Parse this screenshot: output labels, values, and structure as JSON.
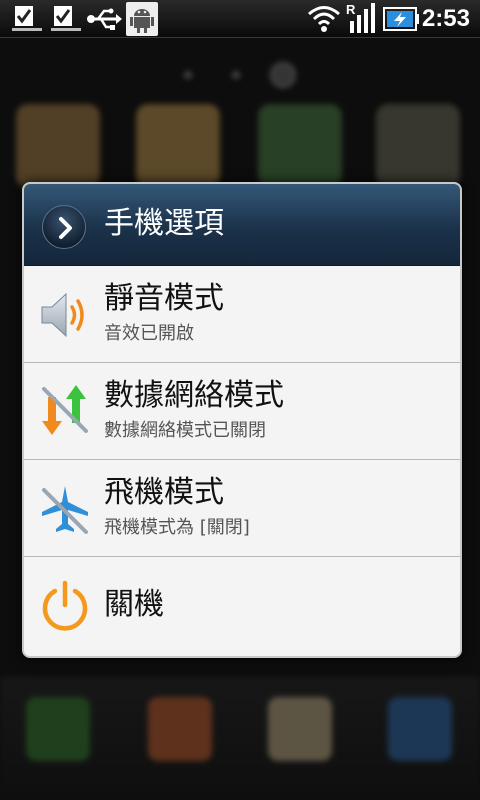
{
  "status_bar": {
    "time": "2:53",
    "roaming_indicator": "R",
    "icons": [
      "task-done-icon",
      "task-done-icon",
      "usb-icon",
      "android-debug-icon",
      "wifi-icon",
      "signal-icon",
      "battery-charging-icon"
    ]
  },
  "dialog": {
    "title": "手機選項",
    "items": [
      {
        "name": "silent-mode",
        "title": "靜音模式",
        "subtitle": "音效已開啟",
        "icon": "speaker-icon"
      },
      {
        "name": "data-network-mode",
        "title": "數據網絡模式",
        "subtitle": "數據網絡模式已關閉",
        "icon": "data-network-icon"
      },
      {
        "name": "airplane-mode",
        "title": "飛機模式",
        "subtitle": "飛機模式為 [關閉]",
        "icon": "airplane-icon"
      },
      {
        "name": "power-off",
        "title": "關機",
        "subtitle": "",
        "icon": "power-icon"
      }
    ]
  },
  "colors": {
    "header_top": "#345878",
    "header_bottom": "#14263a",
    "dialog_bg": "#f4f4f4",
    "power_orange": "#f39a1e",
    "airplane_blue": "#2f8fd8"
  }
}
